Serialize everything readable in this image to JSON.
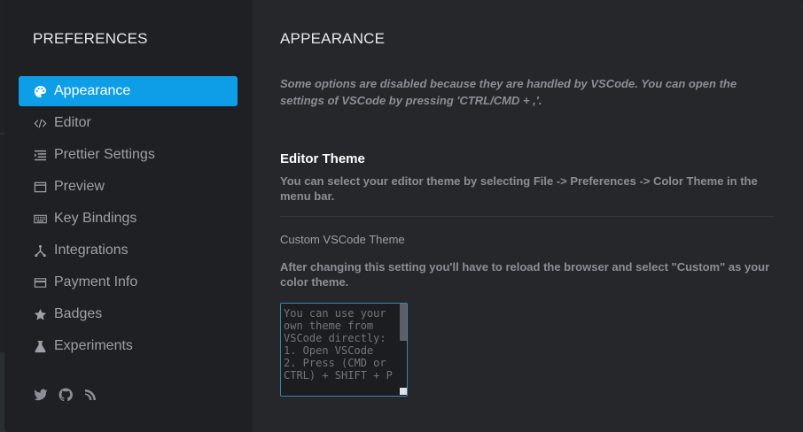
{
  "sidebar": {
    "title": "PREFERENCES",
    "items": [
      {
        "label": "Appearance",
        "icon": "palette-icon",
        "active": true
      },
      {
        "label": "Editor",
        "icon": "code-icon",
        "active": false
      },
      {
        "label": "Prettier Settings",
        "icon": "format-list-icon",
        "active": false
      },
      {
        "label": "Preview",
        "icon": "browser-window-icon",
        "active": false
      },
      {
        "label": "Key Bindings",
        "icon": "keyboard-icon",
        "active": false
      },
      {
        "label": "Integrations",
        "icon": "branch-icon",
        "active": false
      },
      {
        "label": "Payment Info",
        "icon": "credit-card-icon",
        "active": false
      },
      {
        "label": "Badges",
        "icon": "star-icon",
        "active": false
      },
      {
        "label": "Experiments",
        "icon": "flask-icon",
        "active": false
      }
    ],
    "social": [
      "twitter-icon",
      "github-icon",
      "spectrum-icon"
    ]
  },
  "main": {
    "title": "APPEARANCE",
    "notice": "Some options are disabled because they are handled by VSCode. You can open the settings of VSCode by pressing 'CTRL/CMD + ,'.",
    "editor_theme": {
      "title": "Editor Theme",
      "description": "You can select your editor theme by selecting File -> Preferences -> Color Theme in the menu bar."
    },
    "custom_theme": {
      "label": "Custom VSCode Theme",
      "description": "After changing this setting you'll have to reload the browser and select \"Custom\" as your color theme.",
      "placeholder": "You can use your own theme from VSCode directly:\n1. Open VSCode\n2. Press (CMD or CTRL) + SHIFT + P"
    }
  },
  "colors": {
    "accent": "#0e9ee8",
    "sidebar_bg": "#1e2024",
    "content_bg": "#25272b"
  }
}
